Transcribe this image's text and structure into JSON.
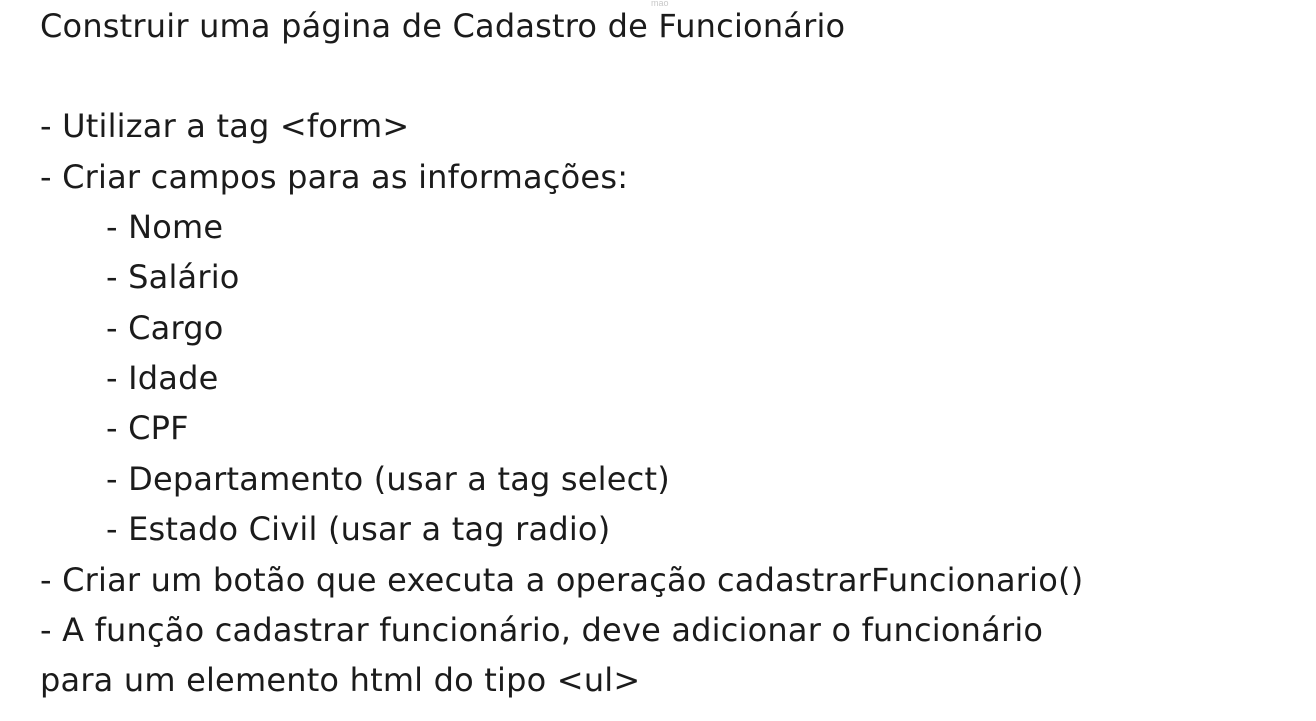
{
  "document": {
    "tiny_label": "mao",
    "title": "Construir uma página de Cadastro de Funcionário",
    "items": [
      "- Utilizar a tag <form>",
      "- Criar campos para as informações:",
      "- Nome",
      "- Salário",
      "- Cargo",
      "- Idade",
      "- CPF",
      "- Departamento (usar a tag select)",
      "- Estado Civil (usar a tag radio)",
      "- Criar um botão que executa a operação cadastrarFuncionario()",
      "- A função cadastrar funcionário, deve adicionar o funcionário",
      "para um elemento html do tipo <ul>"
    ]
  }
}
